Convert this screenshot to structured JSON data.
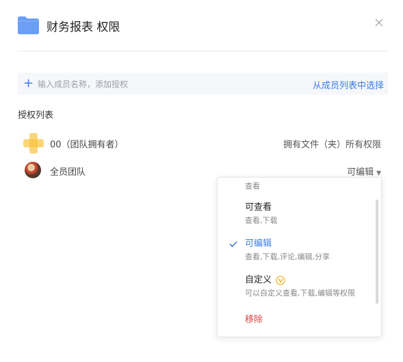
{
  "dialog": {
    "title": "财务报表 权限",
    "folder_color": "#6b9ef5"
  },
  "add_member": {
    "placeholder": "输入成员名称，添加授权",
    "pick_from_list": "从成员列表中选择"
  },
  "auth_list": {
    "label": "授权列表",
    "rows": [
      {
        "name": "00（团队拥有者）",
        "permission": "拥有文件（夹）所有权限"
      },
      {
        "name": "全员团队",
        "permission": "可编辑"
      }
    ]
  },
  "permission_menu": {
    "options": [
      {
        "title": "",
        "desc": "查看"
      },
      {
        "title": "可查看",
        "desc": "查看,下载"
      },
      {
        "title": "可编辑",
        "desc": "查看,下载,评论,编辑,分享",
        "selected": true
      },
      {
        "title": "自定义",
        "desc": "可以自定义查看,下载,编辑等权限",
        "badge": "vip-icon"
      },
      {
        "title": "移除"
      }
    ]
  },
  "colors": {
    "accent": "#3a7ce8",
    "danger": "#e04040"
  }
}
